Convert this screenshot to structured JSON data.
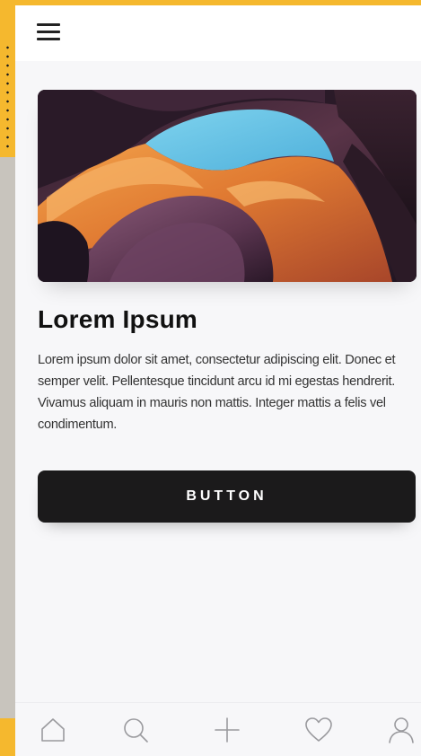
{
  "header": {
    "menu_icon": "hamburger-menu-icon"
  },
  "card": {
    "image_icon": "canyon-photo",
    "title": "Lorem Ipsum",
    "body": "Lorem ipsum dolor sit amet, consectetur adipiscing elit. Donec et semper velit. Pellentesque tincidunt arcu id mi egestas hendrerit. Vivamus aliquam in mauris non mattis. Integer mattis a felis vel condimentum.",
    "button_label": "BUTTON"
  },
  "tabbar": {
    "items": [
      {
        "icon": "home-icon"
      },
      {
        "icon": "search-icon"
      },
      {
        "icon": "plus-icon"
      },
      {
        "icon": "heart-icon"
      },
      {
        "icon": "user-icon"
      }
    ]
  },
  "colors": {
    "accent": "#f5b82e",
    "button_bg": "#1b1a1b",
    "icon_gray": "#9a9a9e"
  }
}
